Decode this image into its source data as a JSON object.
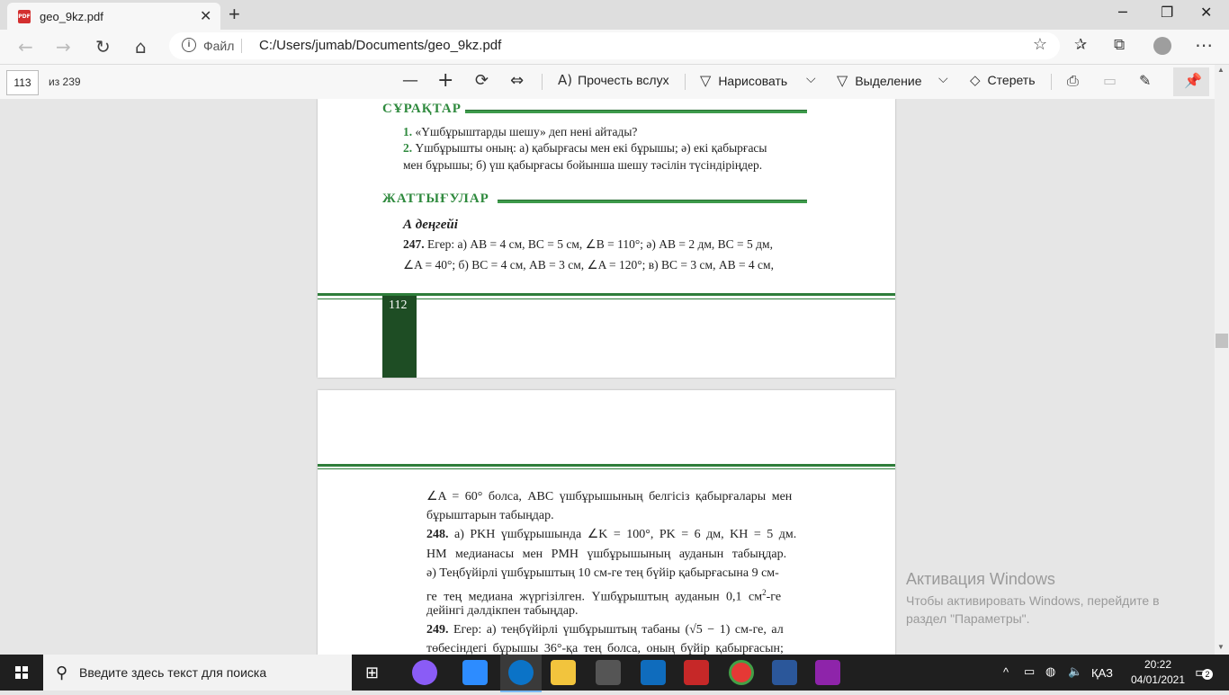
{
  "browser": {
    "tab_title": "geo_9kz.pdf",
    "tab_icon_text": "PDF",
    "address_label": "Файл",
    "url": "C:/Users/jumab/Documents/geo_9kz.pdf"
  },
  "pdf_toolbar": {
    "current_page": "113",
    "page_of": "из 239",
    "read_aloud": "Прочесть вслух",
    "draw": "Нарисовать",
    "highlight": "Выделение",
    "erase": "Стереть"
  },
  "page_top": {
    "questions_heading": "СҰРАҚТАР",
    "q1_num": "1.",
    "q1_text": "«Үшбұрыштарды шешу» деп нені айтады?",
    "q2_num": "2.",
    "q2_line1": "Үшбұрышты оның: а) қабырғасы мен екі бұрышы; ә) екі қабырғасы",
    "q2_line2": "мен бұрышы; б) үш қабырғасы бойынша шешу тәсілін түсіндіріңдер.",
    "exercises_heading": "ЖАТТЫҒУЛАР",
    "level": "А деңгейі",
    "ex247_num": "247.",
    "ex247_line1": "Егер: а) AB = 4 см, BC = 5 см, ∠B = 110°; ә) AB = 2 дм, BC = 5 дм,",
    "ex247_line2": "∠A = 40°; б) BC = 4 см, AB = 3 см, ∠A = 120°; в) BC = 3 см, AB = 4 см,",
    "page_number": "112"
  },
  "page_bottom": {
    "line1": "∠A = 60° болса, ABC үшбұрышының белгісіз қабырғалары мен",
    "line2": "бұрыштарын табыңдар.",
    "ex248_num": "248.",
    "ex248_line1": "а) PKH үшбұрышында ∠K = 100°, PK = 6 дм, KH = 5 дм.",
    "ex248_line2": "HM медианасы мен PMH үшбұрышының ауданын табыңдар.",
    "ex248_line3": "ә) Теңбүйірлі үшбұрыштың 10 см-ге тең бүйір қабырғасына 9 см-",
    "ex248_line4a": "ге тең медиана жүргізілген. Үшбұрыштың ауданын 0,1 см",
    "ex248_line4_sup": "2",
    "ex248_line4b": "-ге",
    "ex248_line5": "дейінгі дәлдікпен табыңдар.",
    "ex249_num": "249.",
    "ex249_line1": "Егер: а) теңбүйірлі үшбұрыштың табаны (√5 − 1) см-ге, ал",
    "ex249_line2": "төбесіндегі бұрышы 36°-қа тең болса, оның бүйір қабырғасын;"
  },
  "watermark": {
    "title": "Активация Windows",
    "line1": "Чтобы активировать Windows, перейдите в",
    "line2": "раздел \"Параметры\"."
  },
  "taskbar": {
    "search_placeholder": "Введите здесь текст для поиска",
    "language": "ҚАЗ",
    "time": "20:22",
    "date": "04/01/2021",
    "notification_count": "2"
  },
  "colors": {
    "green_heading": "#2f8a3e",
    "page_footer_green": "#1e4d24",
    "edge_blue": "#0b73c7"
  }
}
